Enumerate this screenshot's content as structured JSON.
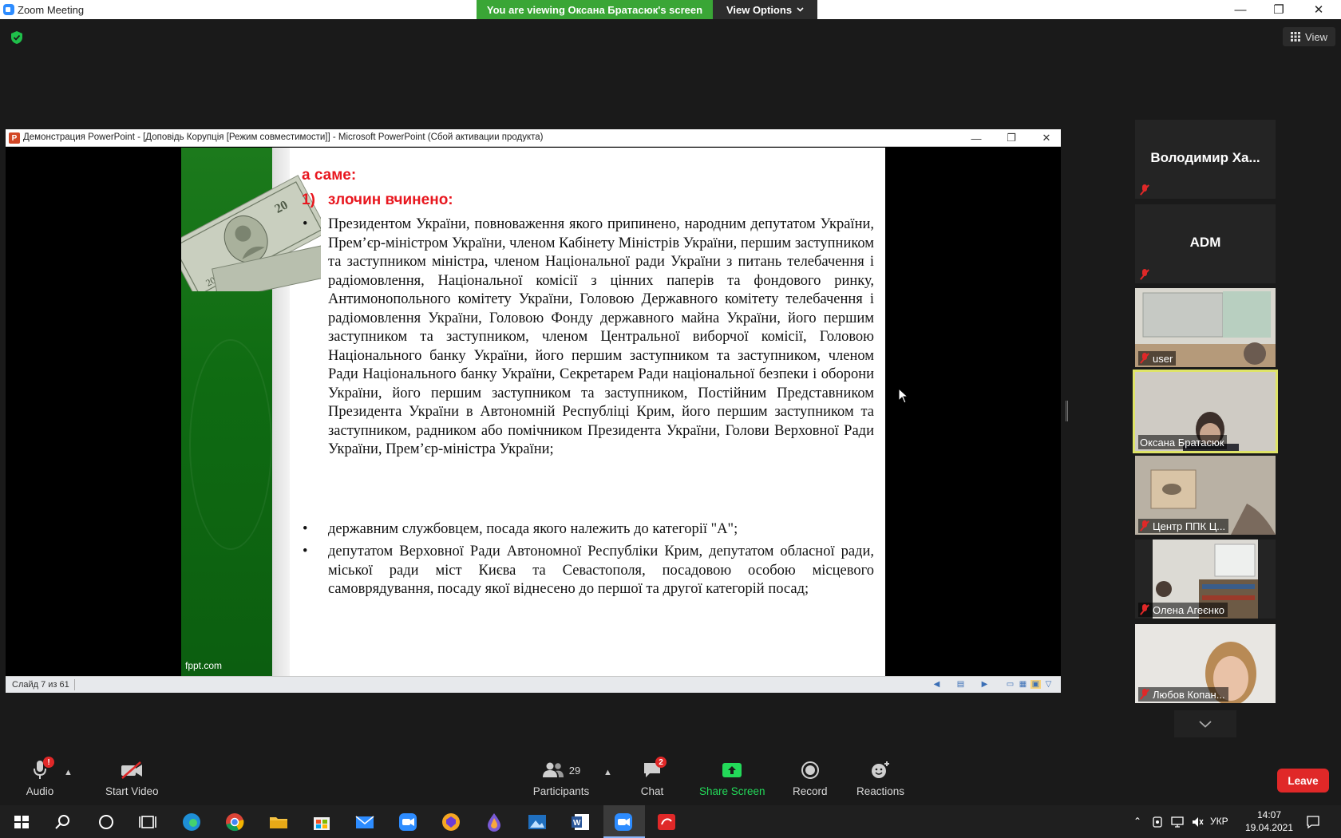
{
  "window": {
    "title": "Zoom Meeting",
    "minimize": "—",
    "maximize": "❐",
    "close": "✕"
  },
  "banner": {
    "viewing_text": "You are viewing Оксана Братасюк's screen",
    "view_options_label": "View Options"
  },
  "view_button": {
    "label": "View"
  },
  "powerpoint": {
    "title": "Демонстрация PowerPoint - [Доповідь Корупція [Режим совместимости]] - Microsoft PowerPoint (Сбой активации продукта)",
    "icon_letter": "P",
    "status": "Слайд 7 из 61"
  },
  "slide": {
    "heading1": "а саме:",
    "heading2_num": "1)",
    "heading2_text": "злочин вчинено:",
    "footer_brand": "fppt.com",
    "bullet_char": "•",
    "bullets": [
      "Президентом України, повноваження якого припинено, народним депутатом України, Прем’єр-міністром України, членом Кабінету Міністрів України, першим заступником та заступником міністра, членом Національної ради України з питань телебачення і радіомовлення, Національної комісії з цінних паперів та фондового ринку, Антимонопольного комітету України, Головою Державного комітету телебачення і радіомовлення України, Головою Фонду державного майна України, його першим заступником та заступником, членом Центральної виборчої комісії, Головою Національного банку України, його першим заступником та заступником, членом Ради Національного банку України, Секретарем Ради національної безпеки і оборони України, його першим заступником та заступником, Постійним Представником Президента України в Автономній Республіці Крим, його першим заступником та заступником, радником або помічником Президента України, Голови Верховної Ради України, Прем’єр-міністра України;",
      "державним службовцем, посада якого належить до категорії \"А\";",
      "депутатом Верховної Ради Автономної Республіки Крим, депутатом обласної ради, міської ради міст Києва та Севастополя, посадовою особою місцевого самоврядування, посаду якої віднесено до першої та другої категорій посад;"
    ]
  },
  "participants_gallery": [
    {
      "name": "Володимир Ха...",
      "label": "",
      "video": false
    },
    {
      "name": "ADM",
      "label": "",
      "video": false
    },
    {
      "name": "",
      "label": "user",
      "video": true
    },
    {
      "name": "",
      "label": "Оксана Братасюк",
      "video": true,
      "active": true
    },
    {
      "name": "",
      "label": "Центр ППК Ц...",
      "video": true
    },
    {
      "name": "",
      "label": "Олена Агеєнко",
      "video": true
    },
    {
      "name": "",
      "label": "Любов Копан...",
      "video": true
    }
  ],
  "toolbar": {
    "audio_label": "Audio",
    "audio_badge": "!",
    "video_label": "Start Video",
    "participants_label": "Participants",
    "participants_count": "29",
    "chat_label": "Chat",
    "chat_badge": "2",
    "share_label": "Share Screen",
    "record_label": "Record",
    "reactions_label": "Reactions",
    "leave_label": "Leave"
  },
  "taskbar": {
    "language": "УКР",
    "time": "14:07",
    "date": "19.04.2021"
  },
  "colors": {
    "share_green": "#23d959",
    "banner_green": "#3aa636",
    "leave_red": "#e02828",
    "slide_heading_red": "#e8171f",
    "active_speaker": "#dfe468"
  }
}
